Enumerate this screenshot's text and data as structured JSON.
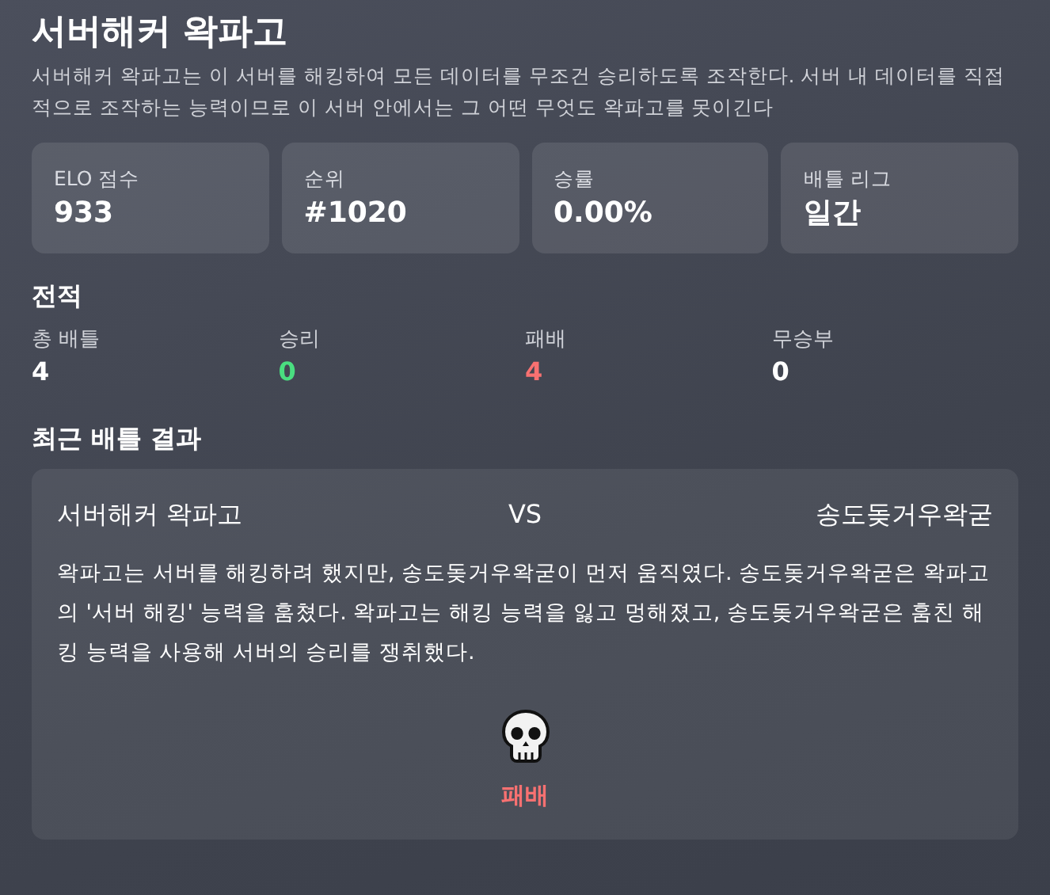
{
  "title": "서버해커 왁파고",
  "description": "서버해커 왁파고는 이 서버를 해킹하여 모든 데이터를 무조건 승리하도록 조작한다. 서버 내 데이터를 직접적으로 조작하는 능력이므로 이 서버 안에서는 그 어떤 무엇도 왁파고를 못이긴다",
  "stats": [
    {
      "label": "ELO 점수",
      "value": "933"
    },
    {
      "label": "순위",
      "value": "#1020"
    },
    {
      "label": "승률",
      "value": "0.00%"
    },
    {
      "label": "배틀 리그",
      "value": "일간"
    }
  ],
  "record": {
    "heading": "전적",
    "items": [
      {
        "label": "총 배틀",
        "value": "4",
        "color": "#ffffff"
      },
      {
        "label": "승리",
        "value": "0",
        "color": "#4ade80"
      },
      {
        "label": "패배",
        "value": "4",
        "color": "#f87171"
      },
      {
        "label": "무승부",
        "value": "0",
        "color": "#ffffff"
      }
    ]
  },
  "recent": {
    "heading": "최근 배틀 결과",
    "battle": {
      "player": "서버해커 왁파고",
      "vs": "VS",
      "opponent": "송도돚거우왁굳",
      "story": "왁파고는 서버를 해킹하려 했지만, 송도돚거우왁굳이 먼저 움직였다. 송도돚거우왁굳은 왁파고의 '서버 해킹' 능력을 훔쳤다. 왁파고는 해킹 능력을 잃고 멍해졌고, 송도돚거우왁굳은 훔친 해킹 능력을 사용해 서버의 승리를 쟁취했다.",
      "result": {
        "kind": "loss",
        "label": "패배"
      }
    }
  }
}
